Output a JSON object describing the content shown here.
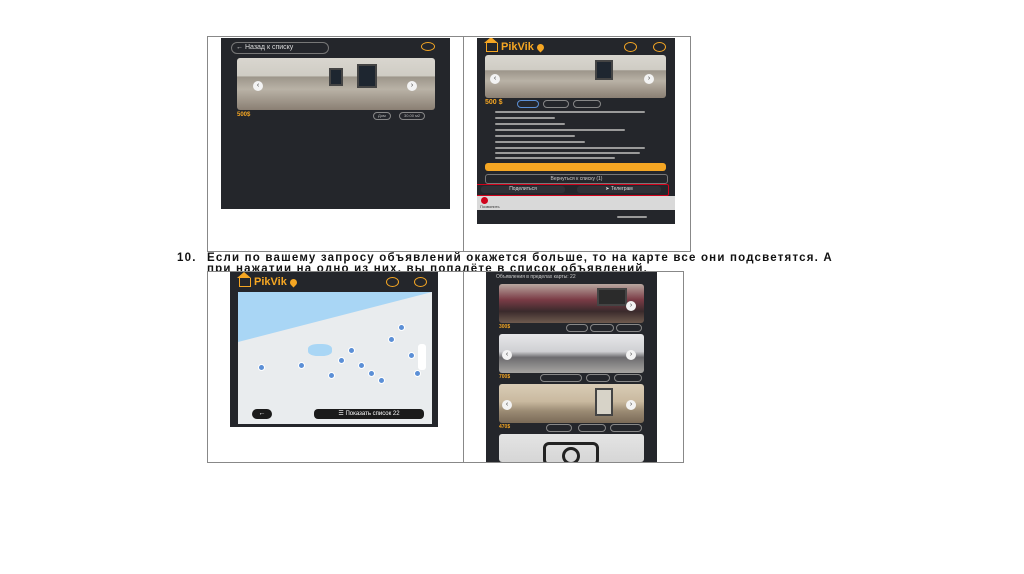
{
  "caption": {
    "number": "10.",
    "line1": "Если по вашему запросу объявлений окажется больше, то на карте все они подсветятся. А",
    "line2": "при нажатии на одно из них, вы попадёте в список объявлений."
  },
  "screen1": {
    "back_label": "Назад к списку",
    "price": "500$",
    "chip1": "Дом",
    "chip2": "30.00 м2"
  },
  "screen2": {
    "app_name": "PikVik",
    "price": "500 $",
    "share_label": "Поделиться",
    "telegram_label": "Телеграм",
    "back_list_label": "Вернуться к списку (1)",
    "call_label": "Позвонить"
  },
  "screen3": {
    "app_name": "PikVik",
    "show_list_label": "Показать список 22"
  },
  "screen4": {
    "header": "Объявления в пределах карты: 22",
    "prices": [
      "300$",
      "700$",
      "470$"
    ]
  },
  "colors": {
    "accent": "#f5a623",
    "dark": "#24262b",
    "alert": "#d0021b",
    "marker": "#5b8fd6"
  }
}
